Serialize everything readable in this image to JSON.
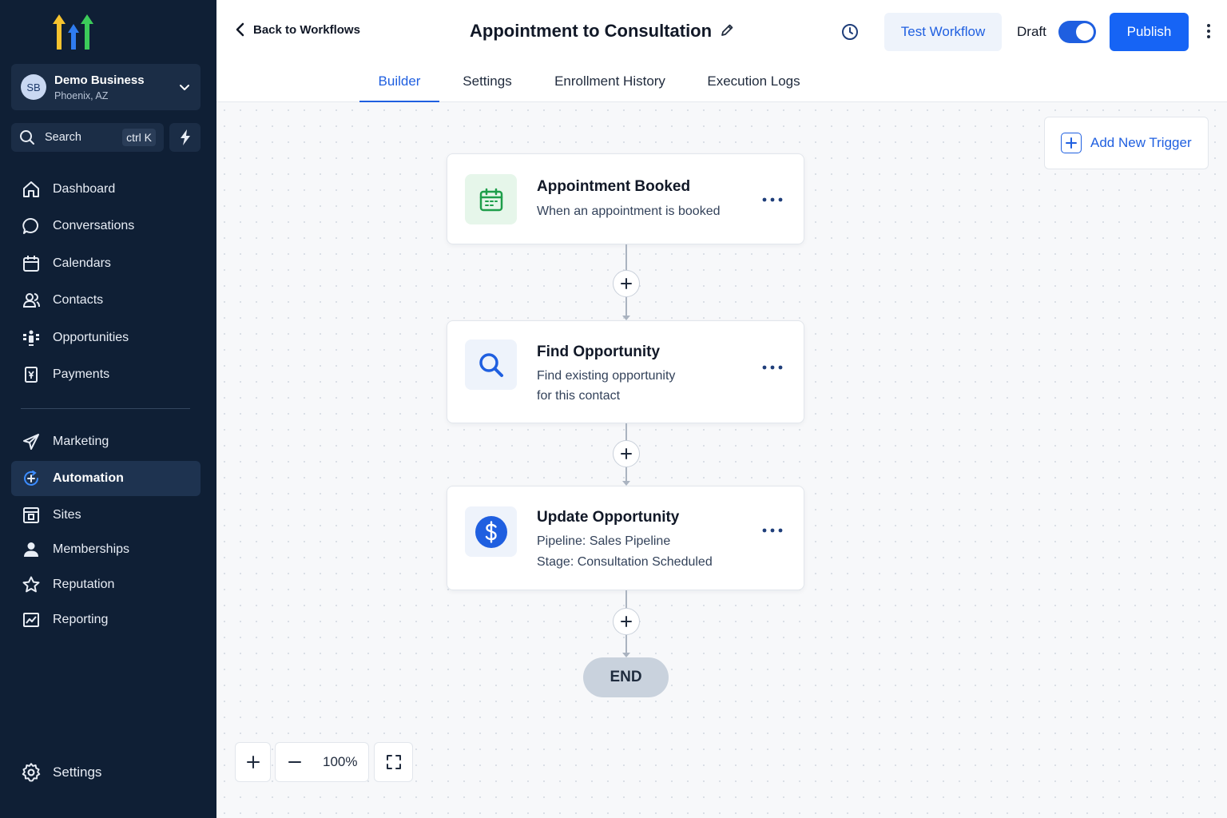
{
  "sidebar": {
    "account": {
      "initials": "SB",
      "name": "Demo Business",
      "location": "Phoenix, AZ"
    },
    "search": {
      "label": "Search",
      "shortcut": "ctrl K"
    },
    "items": [
      {
        "label": "Dashboard",
        "icon": "home-icon"
      },
      {
        "label": "Conversations",
        "icon": "chat-bubble-icon"
      },
      {
        "label": "Calendars",
        "icon": "calendar-icon"
      },
      {
        "label": "Contacts",
        "icon": "contacts-icon"
      },
      {
        "label": "Opportunities",
        "icon": "opportunities-icon"
      },
      {
        "label": "Payments",
        "icon": "payments-icon"
      },
      {
        "label": "Marketing",
        "icon": "send-icon"
      },
      {
        "label": "Automation",
        "icon": "automation-icon"
      },
      {
        "label": "Sites",
        "icon": "sites-icon"
      },
      {
        "label": "Memberships",
        "icon": "user-icon"
      },
      {
        "label": "Reputation",
        "icon": "star-icon"
      },
      {
        "label": "Reporting",
        "icon": "chart-icon"
      }
    ],
    "active_item": "Automation",
    "settings_label": "Settings"
  },
  "header": {
    "back_label": "Back to Workflows",
    "title": "Appointment to Consultation",
    "test_label": "Test Workflow",
    "draft_label": "Draft",
    "publish_label": "Publish",
    "tabs": [
      {
        "label": "Builder"
      },
      {
        "label": "Settings"
      },
      {
        "label": "Enrollment History"
      },
      {
        "label": "Execution Logs"
      }
    ],
    "active_tab": "Builder"
  },
  "canvas": {
    "add_trigger_label": "Add New Trigger",
    "nodes": [
      {
        "title": "Appointment Booked",
        "lines": [
          "When an appointment is booked"
        ],
        "icon": "calendar-icon"
      },
      {
        "title": "Find Opportunity",
        "lines": [
          "Find existing opportunity",
          "for this contact"
        ],
        "icon": "search-icon"
      },
      {
        "title": "Update Opportunity",
        "lines": [
          "Pipeline: Sales Pipeline",
          "Stage: Consultation Scheduled"
        ],
        "icon": "dollar-icon"
      }
    ],
    "end_label": "END",
    "zoom": "100%"
  },
  "colors": {
    "sidebar_bg": "#0f1f35",
    "accent": "#1f5fe0",
    "publish": "#1664f5",
    "trigger_green": "#1e9e4a"
  }
}
